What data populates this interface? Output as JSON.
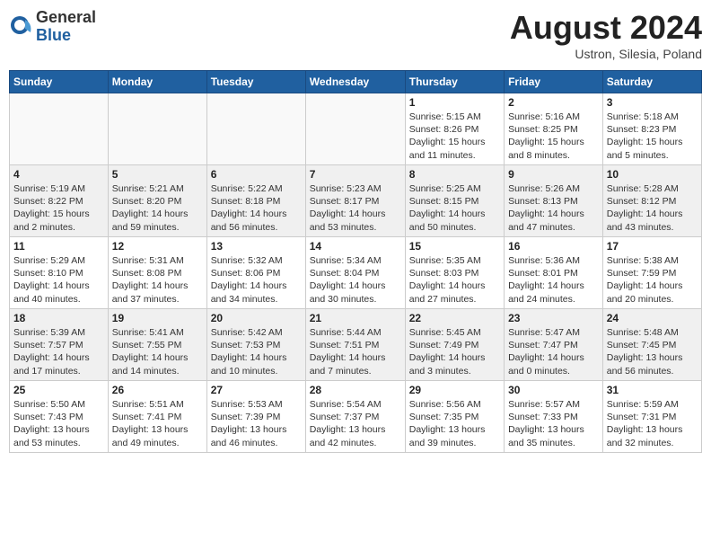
{
  "header": {
    "logo_general": "General",
    "logo_blue": "Blue",
    "month_year": "August 2024",
    "location": "Ustron, Silesia, Poland"
  },
  "weekdays": [
    "Sunday",
    "Monday",
    "Tuesday",
    "Wednesday",
    "Thursday",
    "Friday",
    "Saturday"
  ],
  "weeks": [
    [
      {
        "day": "",
        "info": "",
        "empty": true
      },
      {
        "day": "",
        "info": "",
        "empty": true
      },
      {
        "day": "",
        "info": "",
        "empty": true
      },
      {
        "day": "",
        "info": "",
        "empty": true
      },
      {
        "day": "1",
        "info": "Sunrise: 5:15 AM\nSunset: 8:26 PM\nDaylight: 15 hours\nand 11 minutes."
      },
      {
        "day": "2",
        "info": "Sunrise: 5:16 AM\nSunset: 8:25 PM\nDaylight: 15 hours\nand 8 minutes."
      },
      {
        "day": "3",
        "info": "Sunrise: 5:18 AM\nSunset: 8:23 PM\nDaylight: 15 hours\nand 5 minutes."
      }
    ],
    [
      {
        "day": "4",
        "info": "Sunrise: 5:19 AM\nSunset: 8:22 PM\nDaylight: 15 hours\nand 2 minutes."
      },
      {
        "day": "5",
        "info": "Sunrise: 5:21 AM\nSunset: 8:20 PM\nDaylight: 14 hours\nand 59 minutes."
      },
      {
        "day": "6",
        "info": "Sunrise: 5:22 AM\nSunset: 8:18 PM\nDaylight: 14 hours\nand 56 minutes."
      },
      {
        "day": "7",
        "info": "Sunrise: 5:23 AM\nSunset: 8:17 PM\nDaylight: 14 hours\nand 53 minutes."
      },
      {
        "day": "8",
        "info": "Sunrise: 5:25 AM\nSunset: 8:15 PM\nDaylight: 14 hours\nand 50 minutes."
      },
      {
        "day": "9",
        "info": "Sunrise: 5:26 AM\nSunset: 8:13 PM\nDaylight: 14 hours\nand 47 minutes."
      },
      {
        "day": "10",
        "info": "Sunrise: 5:28 AM\nSunset: 8:12 PM\nDaylight: 14 hours\nand 43 minutes."
      }
    ],
    [
      {
        "day": "11",
        "info": "Sunrise: 5:29 AM\nSunset: 8:10 PM\nDaylight: 14 hours\nand 40 minutes."
      },
      {
        "day": "12",
        "info": "Sunrise: 5:31 AM\nSunset: 8:08 PM\nDaylight: 14 hours\nand 37 minutes."
      },
      {
        "day": "13",
        "info": "Sunrise: 5:32 AM\nSunset: 8:06 PM\nDaylight: 14 hours\nand 34 minutes."
      },
      {
        "day": "14",
        "info": "Sunrise: 5:34 AM\nSunset: 8:04 PM\nDaylight: 14 hours\nand 30 minutes."
      },
      {
        "day": "15",
        "info": "Sunrise: 5:35 AM\nSunset: 8:03 PM\nDaylight: 14 hours\nand 27 minutes."
      },
      {
        "day": "16",
        "info": "Sunrise: 5:36 AM\nSunset: 8:01 PM\nDaylight: 14 hours\nand 24 minutes."
      },
      {
        "day": "17",
        "info": "Sunrise: 5:38 AM\nSunset: 7:59 PM\nDaylight: 14 hours\nand 20 minutes."
      }
    ],
    [
      {
        "day": "18",
        "info": "Sunrise: 5:39 AM\nSunset: 7:57 PM\nDaylight: 14 hours\nand 17 minutes."
      },
      {
        "day": "19",
        "info": "Sunrise: 5:41 AM\nSunset: 7:55 PM\nDaylight: 14 hours\nand 14 minutes."
      },
      {
        "day": "20",
        "info": "Sunrise: 5:42 AM\nSunset: 7:53 PM\nDaylight: 14 hours\nand 10 minutes."
      },
      {
        "day": "21",
        "info": "Sunrise: 5:44 AM\nSunset: 7:51 PM\nDaylight: 14 hours\nand 7 minutes."
      },
      {
        "day": "22",
        "info": "Sunrise: 5:45 AM\nSunset: 7:49 PM\nDaylight: 14 hours\nand 3 minutes."
      },
      {
        "day": "23",
        "info": "Sunrise: 5:47 AM\nSunset: 7:47 PM\nDaylight: 14 hours\nand 0 minutes."
      },
      {
        "day": "24",
        "info": "Sunrise: 5:48 AM\nSunset: 7:45 PM\nDaylight: 13 hours\nand 56 minutes."
      }
    ],
    [
      {
        "day": "25",
        "info": "Sunrise: 5:50 AM\nSunset: 7:43 PM\nDaylight: 13 hours\nand 53 minutes."
      },
      {
        "day": "26",
        "info": "Sunrise: 5:51 AM\nSunset: 7:41 PM\nDaylight: 13 hours\nand 49 minutes."
      },
      {
        "day": "27",
        "info": "Sunrise: 5:53 AM\nSunset: 7:39 PM\nDaylight: 13 hours\nand 46 minutes."
      },
      {
        "day": "28",
        "info": "Sunrise: 5:54 AM\nSunset: 7:37 PM\nDaylight: 13 hours\nand 42 minutes."
      },
      {
        "day": "29",
        "info": "Sunrise: 5:56 AM\nSunset: 7:35 PM\nDaylight: 13 hours\nand 39 minutes."
      },
      {
        "day": "30",
        "info": "Sunrise: 5:57 AM\nSunset: 7:33 PM\nDaylight: 13 hours\nand 35 minutes."
      },
      {
        "day": "31",
        "info": "Sunrise: 5:59 AM\nSunset: 7:31 PM\nDaylight: 13 hours\nand 32 minutes."
      }
    ]
  ]
}
